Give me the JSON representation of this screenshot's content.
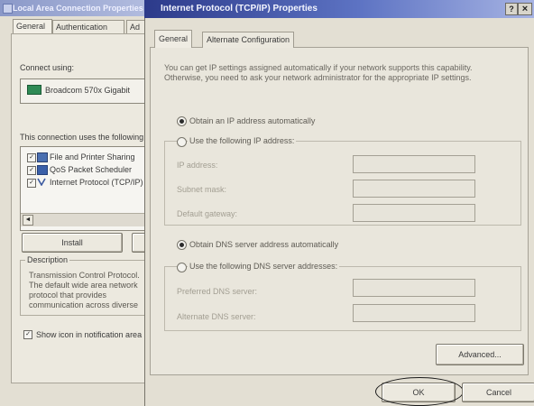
{
  "background_dialog": {
    "title": "Local Area Connection Properties",
    "tabs": [
      "General",
      "Authentication",
      "Ad"
    ],
    "connect_using_label": "Connect using:",
    "adapter_name": "Broadcom 570x Gigabit",
    "components_label": "This connection uses the following items:",
    "components": [
      {
        "label": "File and Printer Sharing",
        "checked": true,
        "icon": "printer-share-icon"
      },
      {
        "label": "QoS Packet Scheduler",
        "checked": true,
        "icon": "qos-icon"
      },
      {
        "label": "Internet Protocol (TCP/IP)",
        "checked": true,
        "icon": "protocol-icon"
      }
    ],
    "scroll_left_glyph": "◄",
    "install_label": "Install",
    "description_label": "Description",
    "description_text": "Transmission Control Protocol. The default wide area network protocol that provides communication across diverse interconnected networks.",
    "show_icon_label": "Show icon in notification area",
    "show_icon_checked": true
  },
  "dialog": {
    "title": "Internet Protocol (TCP/IP) Properties",
    "help_glyph": "?",
    "close_glyph": "×",
    "tabs": {
      "general": "General",
      "alternate": "Alternate Configuration"
    },
    "intro": "You can get IP settings assigned automatically if your network supports this capability. Otherwise, you need to ask your network administrator for the appropriate IP settings.",
    "ip": {
      "auto_label": "Obtain an IP address automatically",
      "manual_label": "Use the following IP address:",
      "selected": "auto",
      "fields": [
        {
          "label": "IP address:",
          "value": ""
        },
        {
          "label": "Subnet mask:",
          "value": ""
        },
        {
          "label": "Default gateway:",
          "value": ""
        }
      ]
    },
    "dns": {
      "auto_label": "Obtain DNS server address automatically",
      "manual_label": "Use the following DNS server addresses:",
      "selected": "auto",
      "fields": [
        {
          "label": "Preferred DNS server:",
          "value": ""
        },
        {
          "label": "Alternate DNS server:",
          "value": ""
        }
      ]
    },
    "advanced_label": "Advanced...",
    "ok_label": "OK",
    "cancel_label": "Cancel"
  },
  "colors": {
    "title_active_start": "#2c3a8a",
    "title_active_end": "#a6b3e3",
    "dialog_face": "#e3dfd3"
  }
}
